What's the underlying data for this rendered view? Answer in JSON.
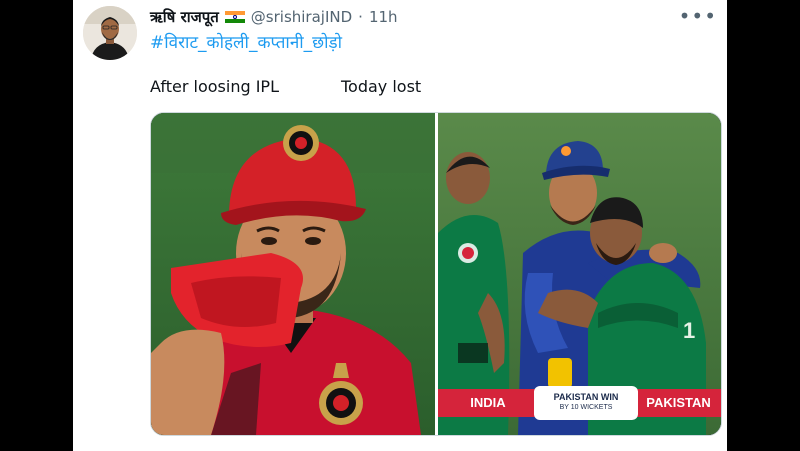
{
  "tweet": {
    "display_name": "ऋषि राजपूत",
    "handle": "@srishirajIND",
    "separator": "·",
    "time": "11h",
    "more_label": "•••",
    "hashtag": "#विराट_कोहली_कप्तानी_छोड़ो",
    "caption_left": "After loosing IPL",
    "caption_right": "Today lost"
  },
  "media": {
    "left_image": "rcb-player-wiping-face",
    "right_image": "india-pakistan-players-hugging",
    "scorebar": {
      "team_left": "INDIA",
      "result_line1": "PAKISTAN WIN",
      "result_line2": "BY 10 WICKETS",
      "team_right": "PAKISTAN"
    }
  },
  "colors": {
    "link": "#1d9bf0",
    "text": "#0f1419",
    "muted": "#536471",
    "rcb_red": "#d42128",
    "india_blue": "#1f3a93",
    "pakistan_green": "#0c7a45"
  }
}
